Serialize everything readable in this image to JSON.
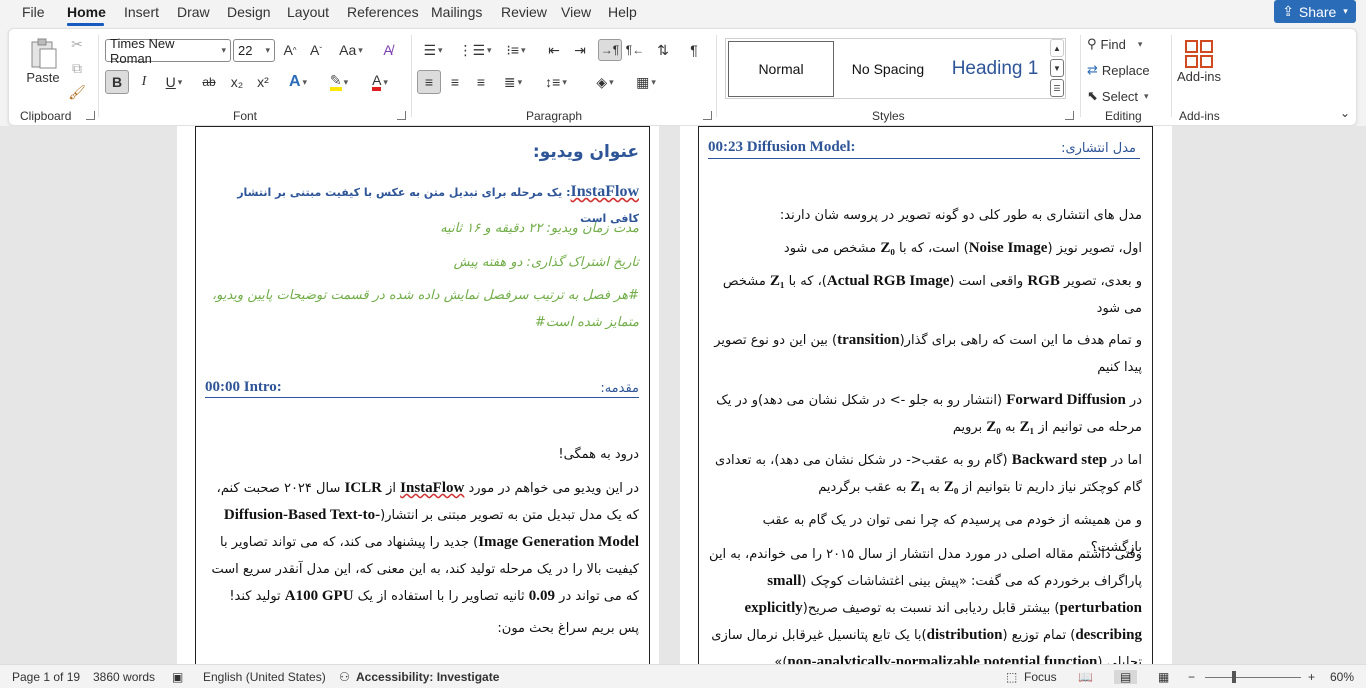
{
  "menu": {
    "tabs": [
      "File",
      "Home",
      "Insert",
      "Draw",
      "Design",
      "Layout",
      "References",
      "Mailings",
      "Review",
      "View",
      "Help"
    ],
    "share": "Share"
  },
  "ribbon": {
    "clipboard": {
      "paste": "Paste",
      "label": "Clipboard"
    },
    "font": {
      "name": "Times New Roman",
      "size": "22",
      "label": "Font",
      "grow": "A˄",
      "shrink": "A˅",
      "case": "Aa",
      "bold": "B",
      "italic": "I",
      "underline": "U",
      "strike": "ab",
      "sub": "x₂",
      "sup": "x²",
      "effects": "A",
      "color": "A"
    },
    "paragraph": {
      "label": "Paragraph",
      "pilcrow": "¶"
    },
    "styles": {
      "label": "Styles",
      "items": [
        "Normal",
        "No Spacing",
        "Heading 1"
      ]
    },
    "editing": {
      "label": "Editing",
      "find": "Find",
      "replace": "Replace",
      "select": "Select"
    },
    "addins": {
      "button": "Add-ins",
      "label": "Add-ins"
    }
  },
  "page_left": {
    "title": "عنوان ویدیو:",
    "subtitle_en": "InstaFlow",
    "subtitle_fa": ": یک مرحله برای تبدیل متن به عکس با کیفیت مبتنی بر انتشار کافی است",
    "duration": "مدت زمان ویدیو: ۲۲ دقیقه و ۱۶ ثانیه",
    "published": "تاریخ اشتراک گذاری: دو هفته پیش",
    "note": "#هر فصل به ترتیب سرفصل نمایش داده شده در قسمت توضیحات پایین ویدیو، متمایز شده است#",
    "intro_en": "00:00 Intro:",
    "intro_fa": "مقدمه:",
    "p1": "درود به همگی!",
    "p2_a": "در این ویدیو می خواهم در مورد ",
    "p2_b": "InstaFlow",
    "p2_c": " از ",
    "p2_d": "ICLR",
    "p2_e": " سال ۲۰۲۴ صحبت کنم، که یک مدل تبدیل متن به تصویر مبتنی بر انتشار(",
    "p2_f": "Diffusion-Based Text-to-Image Generation Model",
    "p2_g": ") جدید را پیشنهاد می کند، که می تواند تصاویر با کیفیت بالا را در یک مرحله تولید کند، به این معنی که، این مدل آنقدر سریع است که می تواند در ",
    "p2_h": "0.09",
    "p2_i": " ثانیه تصاویر را با استفاده از یک ",
    "p2_j": "A100 GPU",
    "p2_k": " تولید کند!",
    "p3": "پس بریم سراغ بحث مون:"
  },
  "page_right": {
    "head_en": "00:23 Diffusion Model:",
    "head_fa": "مدل انتشاری:",
    "r1": "مدل های انتشاری به طور کلی دو گونه تصویر در پروسه شان دارند:",
    "r2_a": "اول، تصویر نویز (",
    "r2_b": "Noise Image",
    "r2_c": ") است، که با ",
    "r2_d": "Z₀",
    "r2_e": " مشخص می شود",
    "r3_a": "و بعدی، تصویر ",
    "r3_b": "RGB",
    "r3_c": " واقعی است (",
    "r3_d": "Actual RGB Image",
    "r3_e": ")، که با ",
    "r3_f": "Z₁",
    "r3_g": " مشخص می شود",
    "r4_a": "و تمام هدف ما این است که راهی برای گذار(",
    "r4_b": "transition",
    "r4_c": ") بین این دو نوع تصویر پیدا کنیم",
    "r5_a": "در ",
    "r5_b": "Forward Diffusion",
    "r5_c": " (انتشار رو به جلو -> در شکل نشان می دهد)و در یک مرحله می توانیم از ",
    "r5_d": "Z₁",
    "r5_e": " به ",
    "r5_f": "Z₀",
    "r5_g": " برویم",
    "r6_a": "اما در ",
    "r6_b": "Backward step",
    "r6_c": " (گام رو به عقب<- در شکل نشان می دهد)، به تعدادی گام کوچکتر نیاز داریم تا بتوانیم از ",
    "r6_d": "Z₀",
    "r6_e": " به ",
    "r6_f": "Z₁",
    "r6_g": " به عقب برگردیم",
    "r7": "و من همیشه از خودم می پرسیدم که چرا نمی توان در یک گام به عقب بازگشت؟",
    "r8_a": "وقتی داشتم مقاله اصلی در مورد مدل انتشار از سال ۲۰۱۵ را می خواندم، به این پاراگراف برخوردم که می گفت: «پیش بینی اغتشاشات کوچک (",
    "r8_b": "small perturbation",
    "r8_c": ") بیشتر قابل ردیابی اند نسبت به توصیف صریح(",
    "r8_d": "explicitly describing",
    "r8_e": ") تمام توزیع (",
    "r8_f": "distribution",
    "r8_g": ")با یک تابع پتانسیل غیرقابل نرمال سازی تحلیلی (",
    "r8_h": "non-analytically-normalizable potential function",
    "r8_i": ")»"
  },
  "status": {
    "page": "Page 1 of 19",
    "words": "3860 words",
    "language": "English (United States)",
    "accessibility": "Accessibility: Investigate",
    "focus": "Focus",
    "zoom": "60%"
  },
  "colors": {
    "accent": "#185abd",
    "heading": "#2e5597",
    "green": "#70ad47",
    "share": "#2b6cb8"
  }
}
